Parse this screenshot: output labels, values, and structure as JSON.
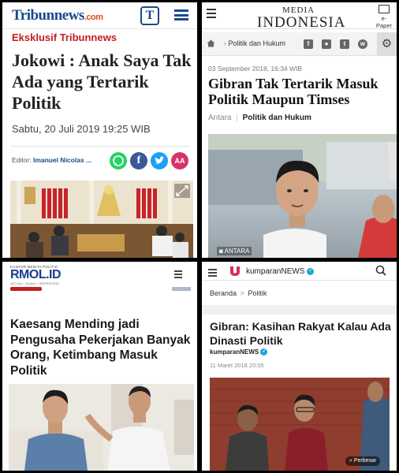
{
  "tribun": {
    "logo_main": "Tribun",
    "logo_suffix": "news",
    "logo_domain": ".com",
    "logo_t": "T",
    "kicker": "Eksklusif Tribunnews",
    "headline": "Jokowi : Anak Saya Tak Ada yang Tertarik Politik",
    "date": "Sabtu, 20 Juli 2019 19:25 WIB",
    "editor_label": "Editor:",
    "editor_name": "Imanuel Nicolas ...",
    "share_icons": [
      "whatsapp-icon",
      "facebook-icon",
      "twitter-icon",
      "font-size-icon"
    ],
    "font_size_label": "AA",
    "colors": {
      "brand": "#1a4a8c",
      "kicker": "#c22020",
      "whatsapp": "#25d366",
      "facebook": "#3b5998",
      "twitter": "#1da1f2",
      "font": "#d6336c"
    }
  },
  "media_indonesia": {
    "logo_small": "MEDIA",
    "logo_big": "INDONESIA",
    "epaper_label": "e-Paper",
    "breadcrumb": "Politik dan Hukum",
    "date": "03 September 2018, 16:34 WIB",
    "headline": "Gibran Tak Tertarik Masuk Politik Maupun Timses",
    "source": "Antara",
    "separator": "|",
    "category": "Politik dan Hukum",
    "photo_credit": "ANTARA"
  },
  "rmol": {
    "logo_small": "KANTOR BERITA POLITIK",
    "logo_main": "RMOL",
    "logo_suffix": ".ID",
    "logo_tagline": "AKTUAL • TAJAM • TERPERCAYA",
    "headline": "Kaesang Mending jadi Pengusaha Pekerjakan Banyak Orang, Ketimbang Masuk Politik"
  },
  "kumparan": {
    "brand": "kumparanNEWS",
    "breadcrumb_home": "Beranda",
    "breadcrumb_sep": ">",
    "breadcrumb_section": "Politik",
    "headline": "Gibran: Kasihan Rakyat Kalau Ada Dinasti Politik",
    "author": "kumparanNEWS",
    "date": "11 Maret 2018 20:05",
    "zoom_label": "Perbesar",
    "colors": {
      "brand": "#d62f55",
      "verified": "#1fa3e0"
    }
  }
}
